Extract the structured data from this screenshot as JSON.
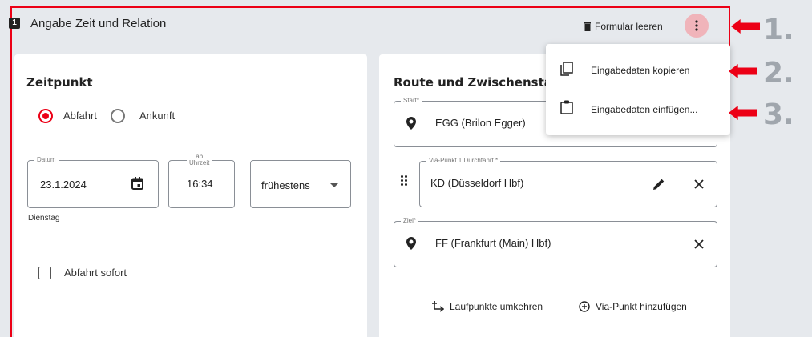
{
  "section": {
    "number": "1",
    "title": "Angabe Zeit und Relation",
    "clear_label": "Formular leeren"
  },
  "left": {
    "title": "Zeitpunkt",
    "radio_departure": "Abfahrt",
    "radio_arrival": "Ankunft",
    "date_label": "Datum",
    "date_value": "23.1.2024",
    "weekday": "Dienstag",
    "time_label_top": "ab",
    "time_label_bottom": "Uhrzeit",
    "time_value": "16:34",
    "timing_select": "frühestens",
    "depart_now_label": "Abfahrt sofort"
  },
  "right": {
    "title": "Route und Zwischensta",
    "start_label": "Start*",
    "start_value": "EGG (Brilon Egger)",
    "via_label": "Via-Punkt 1 Durchfahrt *",
    "via_value": "KD (Düsseldorf Hbf)",
    "dest_label": "Ziel*",
    "dest_value": "FF (Frankfurt (Main) Hbf)",
    "reverse_label": "Laufpunkte umkehren",
    "add_via_label": "Via-Punkt hinzufügen"
  },
  "menu": {
    "copy_label": "Eingabedaten kopieren",
    "paste_label": "Eingabedaten einfügen..."
  },
  "annotations": [
    "1.",
    "2.",
    "3."
  ],
  "colors": {
    "accent": "#ec0016",
    "annotation": "#a0a6ad",
    "background": "#e6e9ed"
  }
}
